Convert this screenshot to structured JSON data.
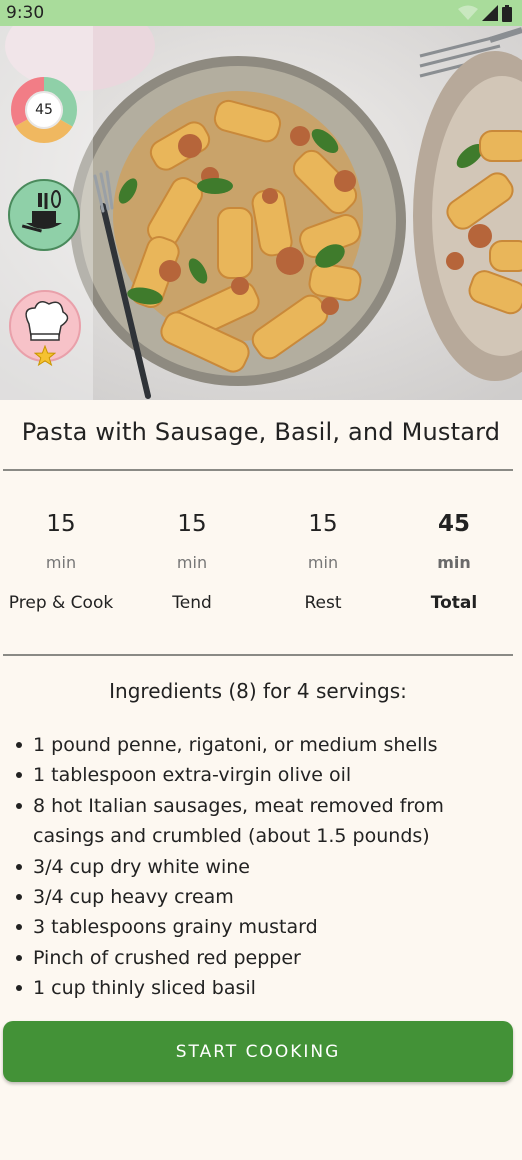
{
  "status_bar": {
    "time": "9:30",
    "icons": [
      "wifi-icon",
      "signal-icon",
      "battery-icon"
    ]
  },
  "hero": {
    "image": "pasta-photo",
    "badges": {
      "total_minutes": "45",
      "ring_colors": [
        "#8fd0a8",
        "#f0b860",
        "#f27d86"
      ],
      "cookware_icon": "cookware-icon",
      "chef_icon": "chef-hat-icon",
      "star_icon": "star-icon"
    }
  },
  "recipe": {
    "title": "Pasta with Sausage, Basil, and Mustard"
  },
  "times": [
    {
      "value": "15",
      "unit": "min",
      "label": "Prep & Cook"
    },
    {
      "value": "15",
      "unit": "min",
      "label": "Tend"
    },
    {
      "value": "15",
      "unit": "min",
      "label": "Rest"
    },
    {
      "value": "45",
      "unit": "min",
      "label": "Total"
    }
  ],
  "ingredients": {
    "heading": "Ingredients (8) for 4 servings:",
    "items": [
      "1 pound penne, rigatoni, or medium shells",
      "1 tablespoon extra-virgin olive oil",
      "8 hot Italian sausages, meat removed from casings and crumbled (about 1.5 pounds)",
      "3/4 cup dry white wine",
      "3/4 cup heavy cream",
      "3 tablespoons grainy mustard",
      "Pinch of crushed red pepper",
      "1 cup thinly sliced basil"
    ]
  },
  "actions": {
    "start_label": "START COOKING"
  },
  "colors": {
    "status_bar": "#a9dc9b",
    "background": "#fdf8f1",
    "primary_button": "#439237"
  }
}
